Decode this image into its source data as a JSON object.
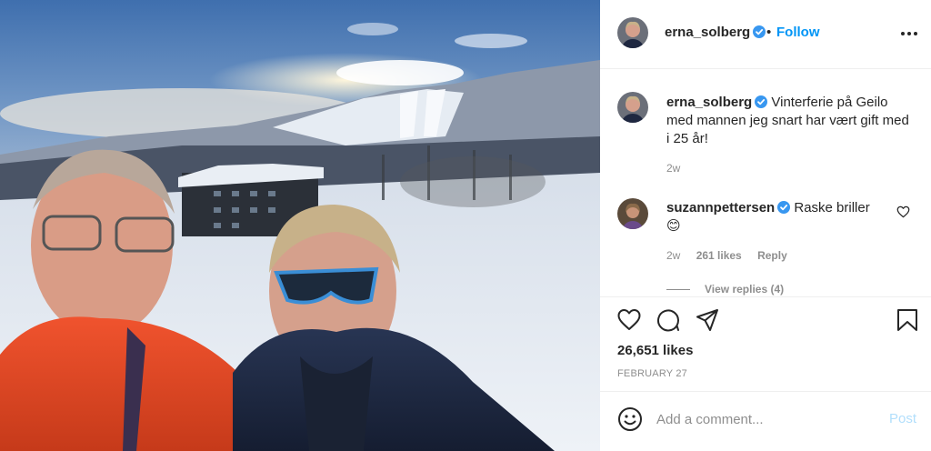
{
  "post": {
    "image_alt": "selfie-in-snowy-mountains",
    "author": {
      "username": "erna_solberg",
      "verified": true
    },
    "follow_separator": "•",
    "follow_label": "Follow",
    "more_icon": "more-dots-icon"
  },
  "caption": {
    "username": "erna_solberg",
    "text": "Vinterferie på Geilo med mannen jeg snart har vært gift med i 25 år!",
    "time": "2w"
  },
  "comment": {
    "username": "suzannpettersen",
    "verified": true,
    "text": "Raske briller",
    "emoji": "😊",
    "time": "2w",
    "likes": "261 likes",
    "reply_label": "Reply",
    "view_replies": "View replies (4)"
  },
  "actions": {
    "like_icon": "heart-icon",
    "comment_icon": "comment-bubble-icon",
    "share_icon": "paper-plane-icon",
    "save_icon": "bookmark-icon",
    "likes": "26,651 likes",
    "date": "FEBRUARY 27"
  },
  "add_comment": {
    "emoji_icon": "smiley-icon",
    "placeholder": "Add a comment...",
    "post_label": "Post"
  },
  "colors": {
    "link_blue": "#0095f6",
    "post_disabled": "#b2dffc",
    "verified_blue": "#3897f0",
    "muted_text": "#8e8e8e",
    "text": "#262626",
    "divider": "#efefef"
  }
}
